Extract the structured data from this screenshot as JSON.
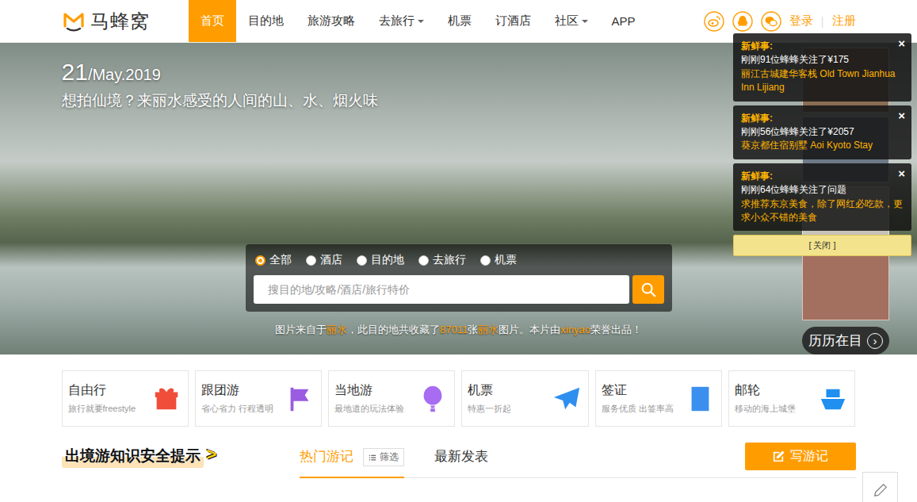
{
  "logo": {
    "text": "马蜂窝"
  },
  "nav": [
    {
      "label": "首页",
      "selected": true,
      "dropdown": false
    },
    {
      "label": "目的地",
      "selected": false,
      "dropdown": false
    },
    {
      "label": "旅游攻略",
      "selected": false,
      "dropdown": false
    },
    {
      "label": "去旅行",
      "selected": false,
      "dropdown": true
    },
    {
      "label": "机票",
      "selected": false,
      "dropdown": false
    },
    {
      "label": "订酒店",
      "selected": false,
      "dropdown": false
    },
    {
      "label": "社区",
      "selected": false,
      "dropdown": true
    },
    {
      "label": "APP",
      "selected": false,
      "dropdown": false
    }
  ],
  "auth": {
    "login": "登录",
    "separator": "|",
    "register": "注册"
  },
  "hero": {
    "day": "21",
    "date": "/May.2019",
    "title": "想拍仙境？来丽水感受的人间的山、水、烟火味"
  },
  "search": {
    "options": [
      {
        "label": "全部",
        "selected": true
      },
      {
        "label": "酒店",
        "selected": false
      },
      {
        "label": "目的地",
        "selected": false
      },
      {
        "label": "去旅行",
        "selected": false
      },
      {
        "label": "机票",
        "selected": false
      }
    ],
    "placeholder": "搜目的地/攻略/酒店/旅行特价"
  },
  "caption": [
    {
      "text": "图片来自于",
      "highlight": false
    },
    {
      "text": "丽水",
      "highlight": true
    },
    {
      "text": "，此目的地共收藏了",
      "highlight": false
    },
    {
      "text": "87011",
      "highlight": true
    },
    {
      "text": "张",
      "highlight": false
    },
    {
      "text": "丽水",
      "highlight": true
    },
    {
      "text": "图片。本片由",
      "highlight": false
    },
    {
      "text": "xinyao",
      "highlight": true
    },
    {
      "text": "荣誉出品！",
      "highlight": false
    }
  ],
  "gallery": {
    "label": "历历在目",
    "arrow": "›"
  },
  "notifications": {
    "items": [
      {
        "heading": "新鲜事:",
        "line": "刚刚91位蜂蜂关注了¥175",
        "link": "丽江古城建华客栈 Old Town Jianhua Inn Lijiang",
        "close": "×"
      },
      {
        "heading": "新鲜事:",
        "line": "刚刚56位蜂蜂关注了¥2057",
        "link": "葵京都住宿别墅 Aoi Kyoto Stay",
        "close": "×"
      },
      {
        "heading": "新鲜事:",
        "line": "刚刚64位蜂蜂关注了问题",
        "link": "求推荐东京美食，除了网红必吃款，更求小众不错的美食",
        "close": "×"
      }
    ],
    "close_all": "[ 关闭 ]"
  },
  "services": [
    {
      "title": "自由行",
      "subtitle": "旅行就要freestyle",
      "color": "#f04d3b"
    },
    {
      "title": "跟团游",
      "subtitle": "省心省力 行程透明",
      "color": "#9a5ce0"
    },
    {
      "title": "当地游",
      "subtitle": "最地道的玩法体验",
      "color": "#a76cf2"
    },
    {
      "title": "机票",
      "subtitle": "特惠一折起",
      "color": "#2f8ff0"
    },
    {
      "title": "签证",
      "subtitle": "服务优质 出签率高",
      "color": "#3b8fef"
    },
    {
      "title": "邮轮",
      "subtitle": "移动的海上城堡",
      "color": "#1f8ff0"
    }
  ],
  "notice": {
    "text": "出境游知识安全提示",
    "arrow": ">"
  },
  "tabs": [
    {
      "label": "热门游记",
      "selected": true
    },
    {
      "label": "最新发表",
      "selected": false
    }
  ],
  "filter": {
    "label": "筛选"
  },
  "write_button": {
    "label": "写游记"
  }
}
